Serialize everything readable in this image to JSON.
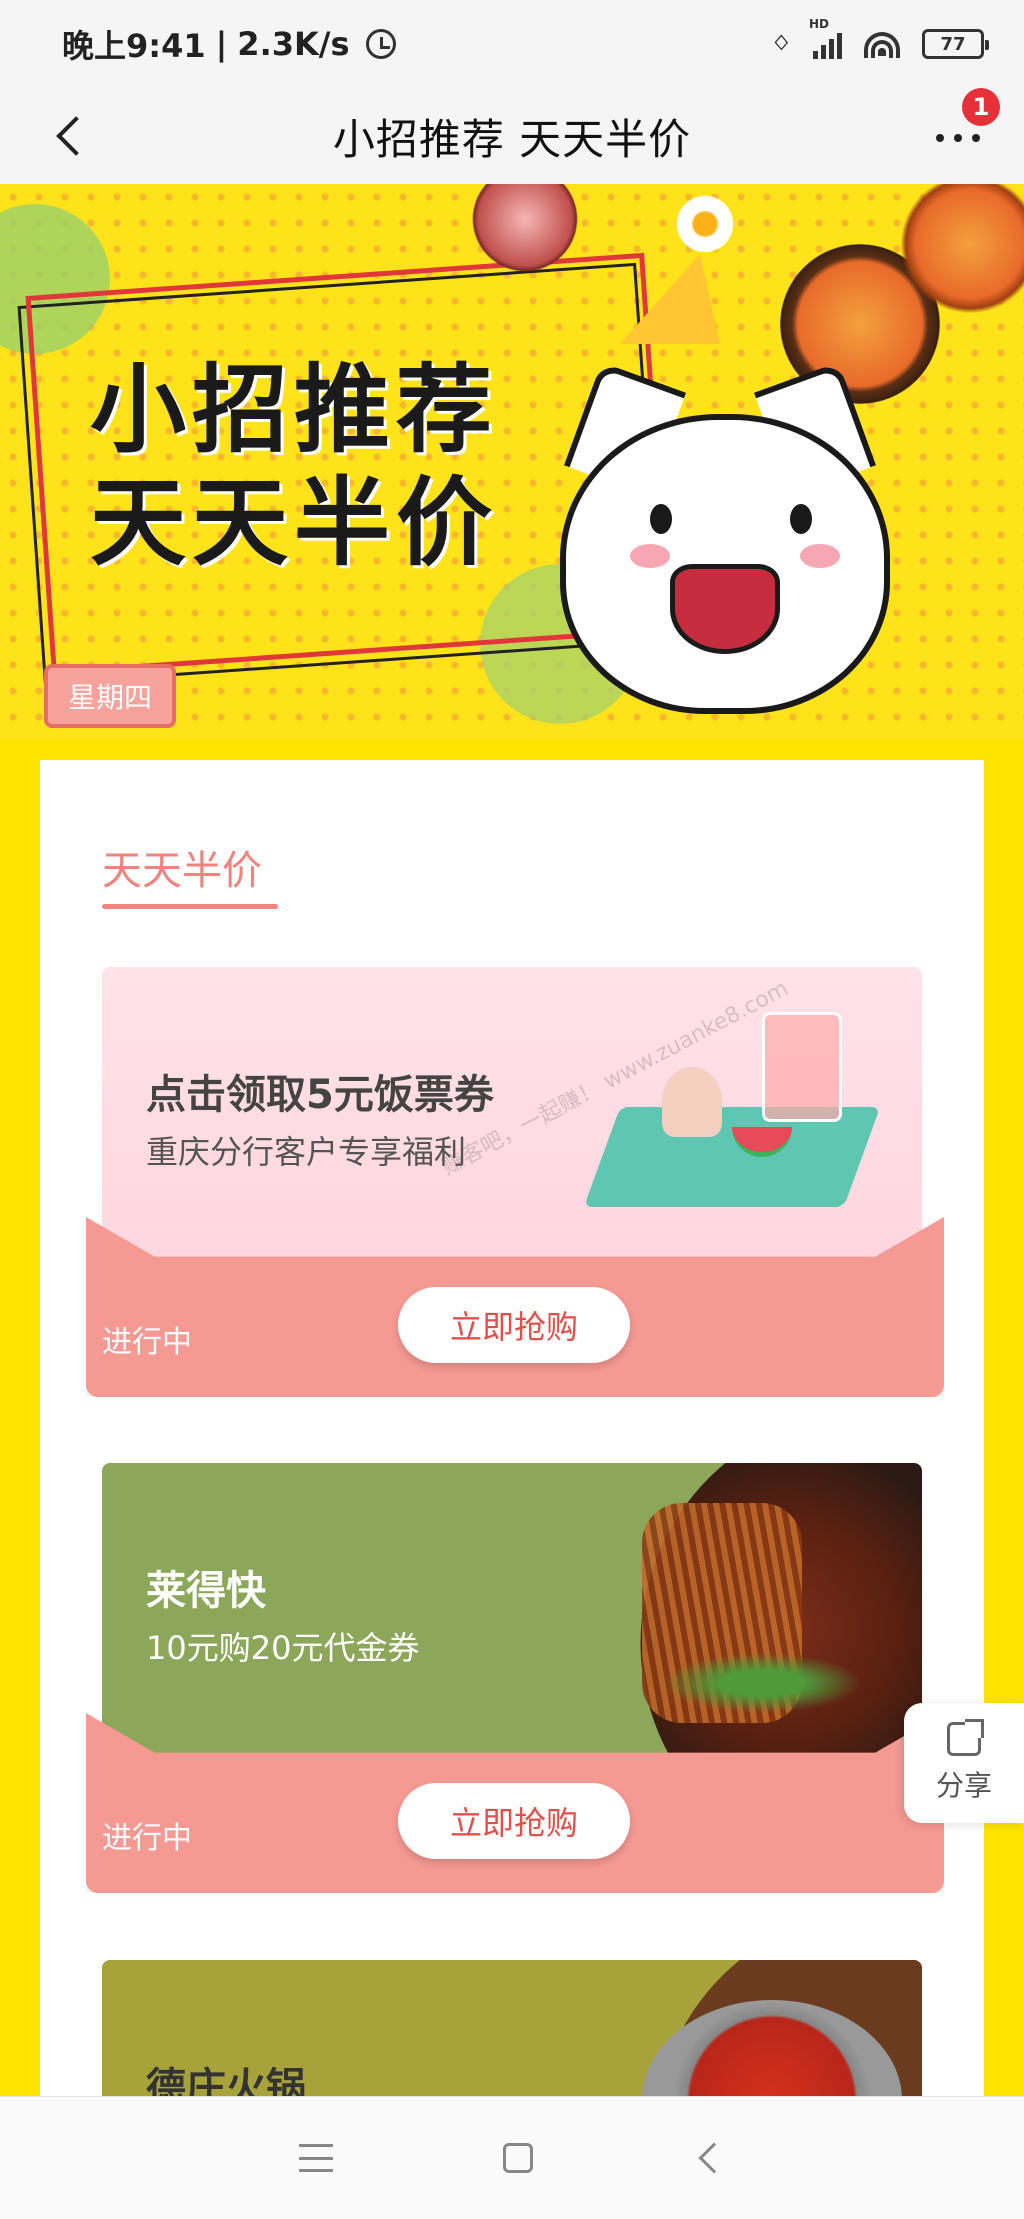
{
  "status_bar": {
    "time": "晚上9:41",
    "speed": "2.3K/s",
    "network_type": "HD",
    "battery": "77"
  },
  "nav": {
    "title": "小招推荐 天天半价",
    "badge_count": "1"
  },
  "banner": {
    "title_line1": "小招推荐",
    "title_line2": "天天半价",
    "weekday": "星期四"
  },
  "section": {
    "title": "天天半价"
  },
  "cards": [
    {
      "title": "点击领取5元饭票券",
      "subtitle": "重庆分行客户专享福利",
      "status": "进行中",
      "button": "立即抢购"
    },
    {
      "title": "莱得快",
      "subtitle": "10元购20元代金券",
      "status": "进行中",
      "button": "立即抢购"
    },
    {
      "title": "德庄火锅"
    }
  ],
  "share": {
    "label": "分享"
  },
  "colors": {
    "brand_yellow": "#ffe400",
    "accent_pink": "#f59993",
    "title_pink": "#f0837e",
    "button_text": "#e0504b"
  },
  "watermark": "赚客吧，一起赚！ www.zuanke8.com"
}
